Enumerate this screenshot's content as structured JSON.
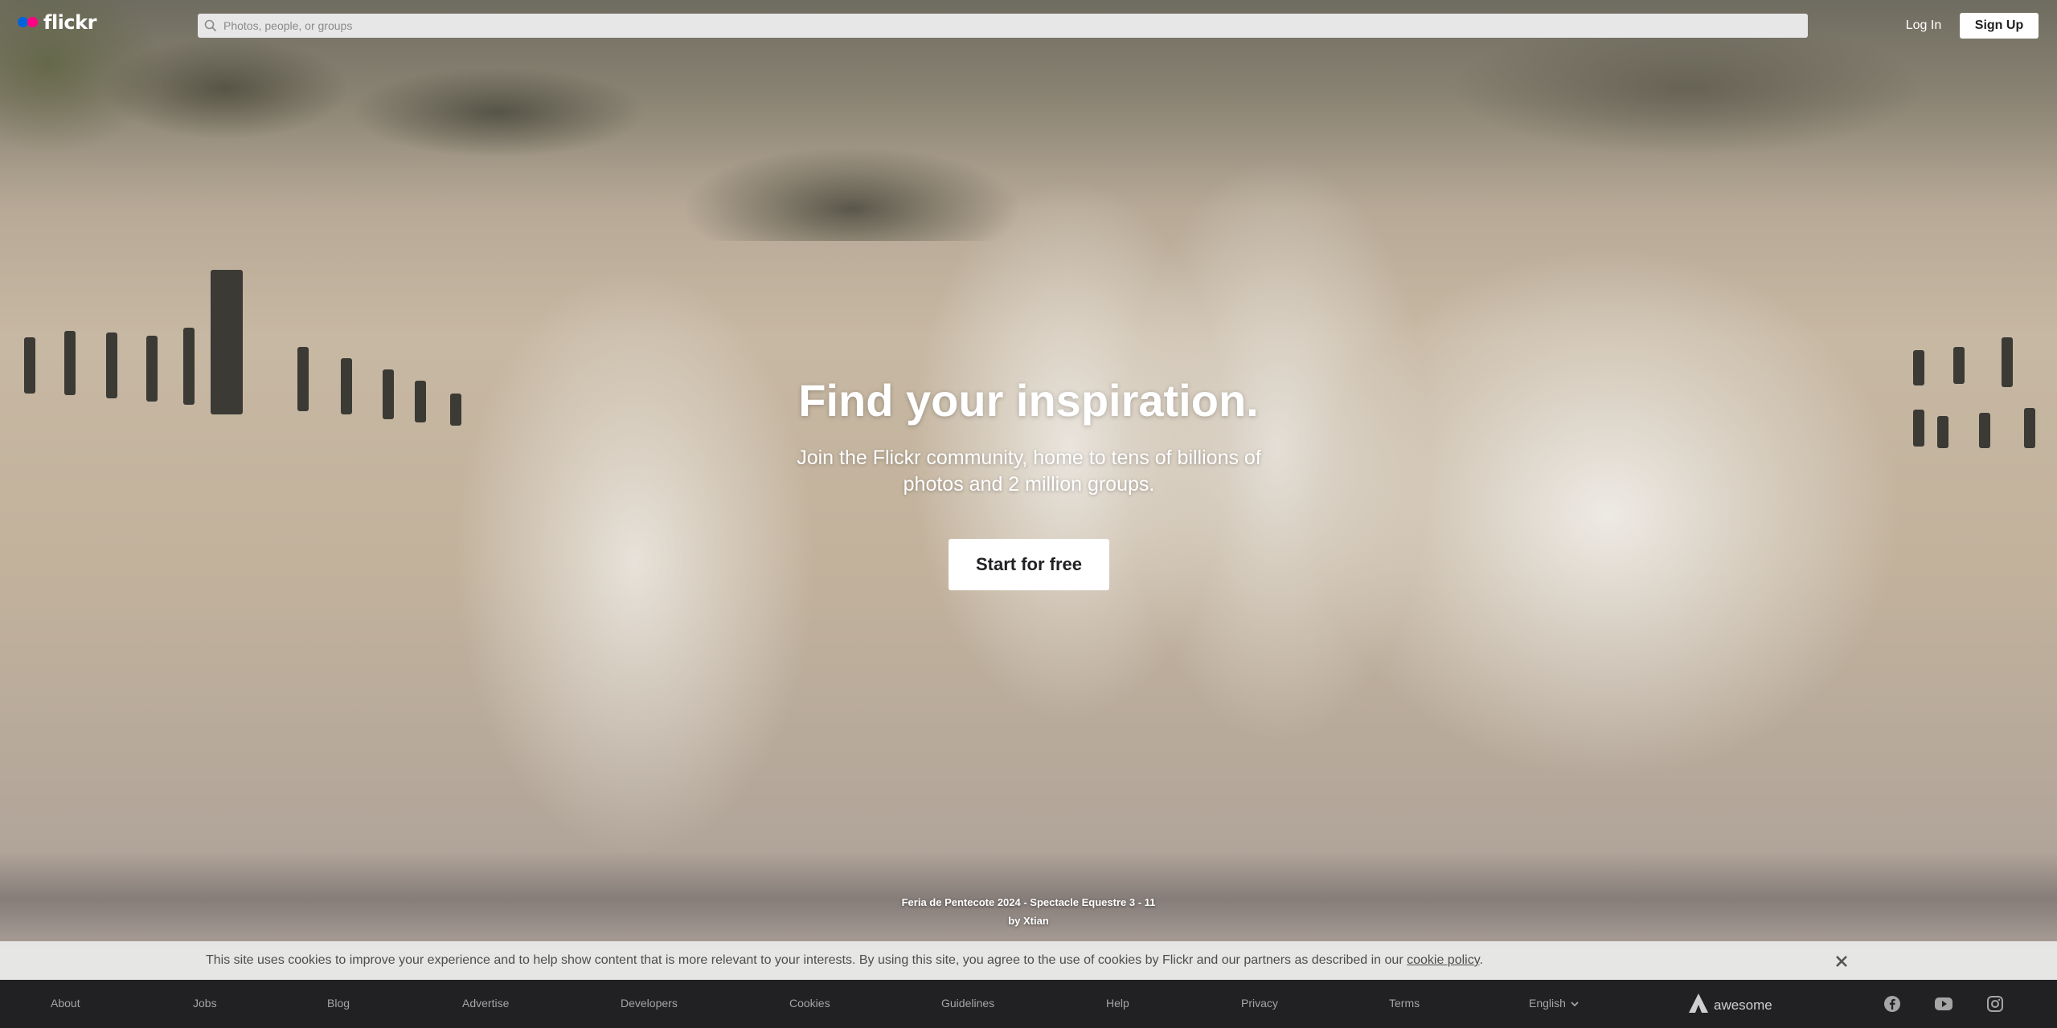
{
  "header": {
    "logo_text": "flickr",
    "search_placeholder": "Photos, people, or groups",
    "login_label": "Log In",
    "signup_label": "Sign Up"
  },
  "hero": {
    "title": "Find your inspiration.",
    "subtitle": "Join the Flickr community, home to tens of billions of photos and 2 million groups.",
    "cta_label": "Start for free",
    "photo_title": "Feria de Pentecote 2024 - Spectacle Equestre 3 - 11",
    "photo_author": "by Xtian"
  },
  "cookie_banner": {
    "text": "This site uses cookies to improve your experience and to help show content that is more relevant to your interests. By using this site, you agree to the use of cookies by Flickr and our partners as described in our",
    "link_label": "cookie policy",
    "trailing": ".",
    "close_icon": "close-icon"
  },
  "footer": {
    "links": [
      "About",
      "Jobs",
      "Blog",
      "Advertise",
      "Developers",
      "Cookies",
      "Guidelines",
      "Help",
      "Privacy",
      "Terms"
    ],
    "language": "English",
    "brand": "awesome",
    "social_icons": [
      "facebook-icon",
      "youtube-icon",
      "instagram-icon"
    ]
  },
  "colors": {
    "flickr_blue": "#0063dc",
    "flickr_pink": "#ff0084",
    "footer_bg": "#212124"
  }
}
